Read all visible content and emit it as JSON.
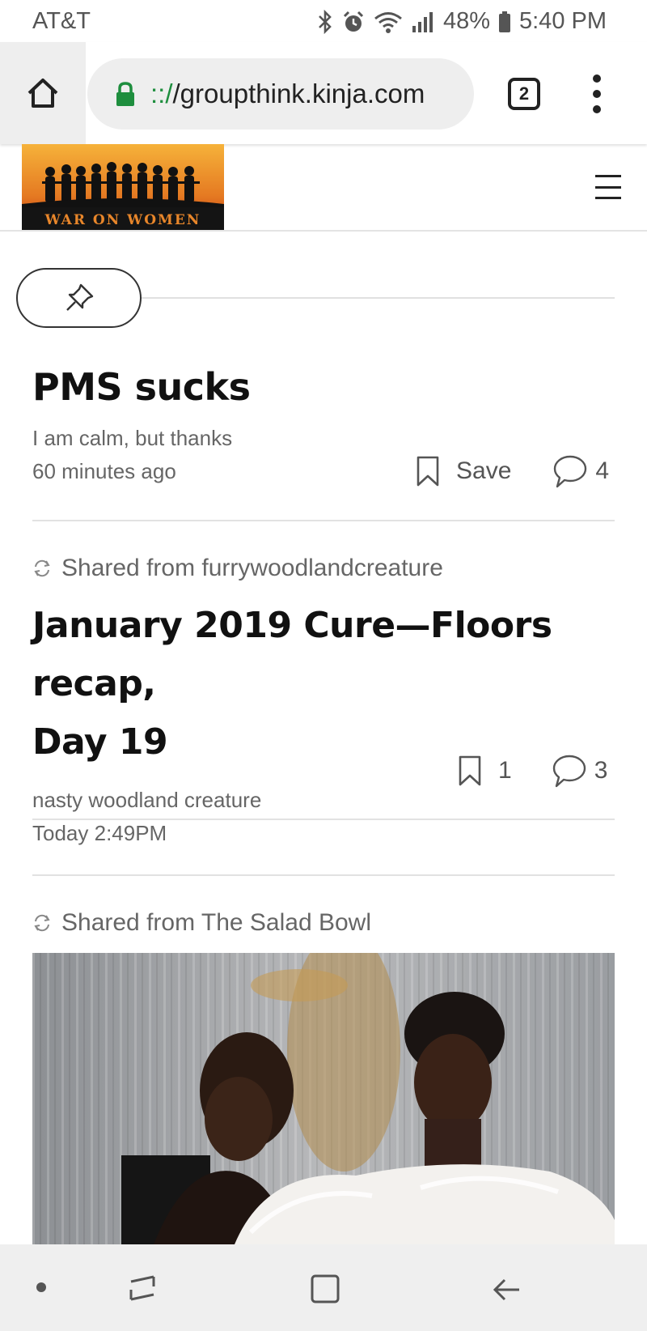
{
  "status_bar": {
    "carrier": "AT&T",
    "battery": "48%",
    "time": "5:40 PM"
  },
  "browser": {
    "url_scheme": "::/",
    "url_host": "/groupthink.kinja.com",
    "tab_count": "2"
  },
  "site": {
    "logo_text": "WAR ON WOMEN"
  },
  "posts": [
    {
      "title": "PMS sucks",
      "author": "I am calm, but thanks",
      "time": "60 minutes ago",
      "save_label": "Save",
      "comments": "4"
    },
    {
      "shared_from": "Shared from furrywoodlandcreature",
      "title_line1": "January 2019 Cure—Floors recap,",
      "title_line2": "Day 19",
      "author": "nasty woodland creature",
      "time": "Today 2:49PM",
      "saves": "1",
      "comments": "3"
    },
    {
      "shared_from": "Shared from The Salad Bowl"
    }
  ],
  "colors": {
    "lock_green": "#1e8e3e",
    "text_dark": "#111111",
    "text_muted": "#666666",
    "logo_orange": "#e8862a"
  }
}
